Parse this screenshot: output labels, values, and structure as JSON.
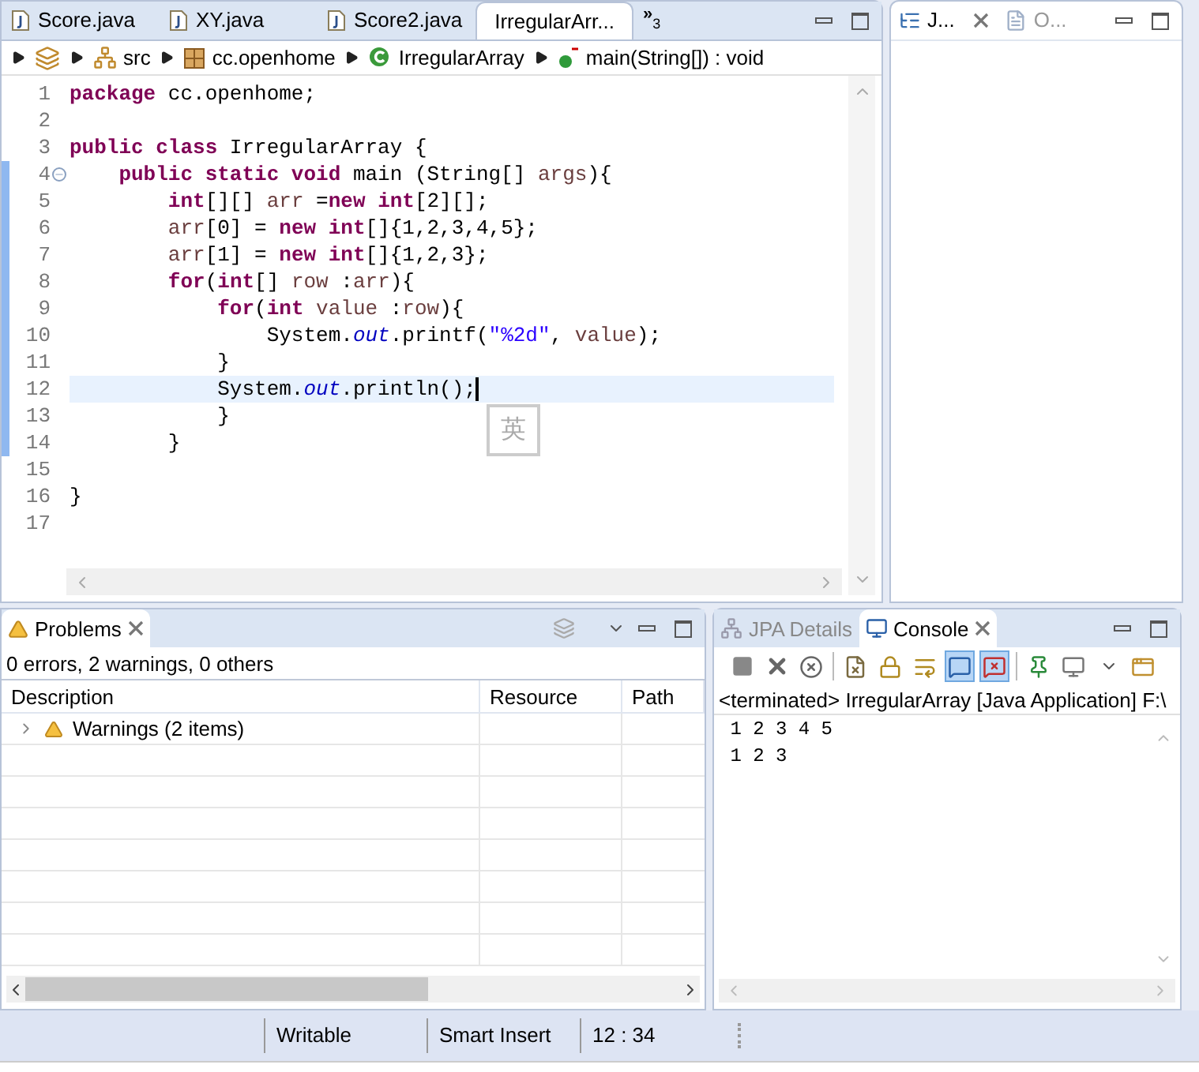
{
  "editor": {
    "tabs": [
      {
        "label": "Score.java",
        "selected": false
      },
      {
        "label": "XY.java",
        "selected": false
      },
      {
        "label": "Score2.java",
        "selected": false
      },
      {
        "label": "IrregularArr...",
        "selected": true
      }
    ],
    "overflow": {
      "symbol": "»",
      "count": "3"
    },
    "breadcrumb": [
      {
        "kind": "project"
      },
      {
        "kind": "folder",
        "label": "src"
      },
      {
        "kind": "package",
        "label": "cc.openhome"
      },
      {
        "kind": "class",
        "label": "IrregularArray"
      },
      {
        "kind": "method",
        "label": "main(String[]) : void"
      }
    ],
    "lines": [
      {
        "number": "1",
        "changed": false,
        "current": false,
        "tokens": [
          {
            "kind": "keyword",
            "text": "package"
          },
          {
            "kind": "plain",
            "text": " cc.openhome;"
          }
        ]
      },
      {
        "number": "2",
        "changed": false,
        "current": false
      },
      {
        "number": "3",
        "changed": false,
        "current": false,
        "tokens": [
          {
            "kind": "keyword",
            "text": "public class"
          },
          {
            "kind": "plain",
            "text": " IrregularArray {"
          }
        ]
      },
      {
        "number": "4",
        "changed": true,
        "current": false,
        "foldable": true,
        "tokens": [
          {
            "kind": "keyword",
            "text": "    public static void"
          },
          {
            "kind": "plain",
            "text": " main (String[] "
          },
          {
            "kind": "variable",
            "text": "args"
          },
          {
            "kind": "plain",
            "text": "){"
          }
        ]
      },
      {
        "number": "5",
        "changed": true,
        "current": false,
        "tokens": [
          {
            "kind": "keyword",
            "text": "        int"
          },
          {
            "kind": "plain",
            "text": "[][] "
          },
          {
            "kind": "variable",
            "text": "arr"
          },
          {
            "kind": "plain",
            "text": " ="
          },
          {
            "kind": "keyword",
            "text": "new int"
          },
          {
            "kind": "plain",
            "text": "[2][];"
          }
        ]
      },
      {
        "number": "6",
        "changed": true,
        "current": false,
        "tokens": [
          {
            "kind": "variable",
            "text": "        arr"
          },
          {
            "kind": "plain",
            "text": "[0] = "
          },
          {
            "kind": "keyword",
            "text": "new int"
          },
          {
            "kind": "plain",
            "text": "[]{1,2,3,4,5};"
          }
        ]
      },
      {
        "number": "7",
        "changed": true,
        "current": false,
        "tokens": [
          {
            "kind": "variable",
            "text": "        arr"
          },
          {
            "kind": "plain",
            "text": "[1] = "
          },
          {
            "kind": "keyword",
            "text": "new int"
          },
          {
            "kind": "plain",
            "text": "[]{1,2,3};"
          }
        ]
      },
      {
        "number": "8",
        "changed": true,
        "current": false,
        "tokens": [
          {
            "kind": "keyword",
            "text": "        for"
          },
          {
            "kind": "plain",
            "text": "("
          },
          {
            "kind": "keyword",
            "text": "int"
          },
          {
            "kind": "plain",
            "text": "[] "
          },
          {
            "kind": "variable",
            "text": "row"
          },
          {
            "kind": "plain",
            "text": " :"
          },
          {
            "kind": "variable",
            "text": "arr"
          },
          {
            "kind": "plain",
            "text": "){"
          }
        ]
      },
      {
        "number": "9",
        "changed": true,
        "current": false,
        "tokens": [
          {
            "kind": "keyword",
            "text": "            for"
          },
          {
            "kind": "plain",
            "text": "("
          },
          {
            "kind": "keyword",
            "text": "int"
          },
          {
            "kind": "variable",
            "text": " value"
          },
          {
            "kind": "plain",
            "text": " :"
          },
          {
            "kind": "variable",
            "text": "row"
          },
          {
            "kind": "plain",
            "text": "){"
          }
        ]
      },
      {
        "number": "10",
        "changed": true,
        "current": false,
        "tokens": [
          {
            "kind": "plain",
            "text": "                System."
          },
          {
            "kind": "field",
            "text": "out"
          },
          {
            "kind": "plain",
            "text": ".printf("
          },
          {
            "kind": "string",
            "text": "\"%2d\""
          },
          {
            "kind": "plain",
            "text": ", "
          },
          {
            "kind": "variable",
            "text": "value"
          },
          {
            "kind": "plain",
            "text": ");"
          }
        ]
      },
      {
        "number": "11",
        "changed": true,
        "current": false,
        "tokens": [
          {
            "kind": "plain",
            "text": "            }"
          }
        ]
      },
      {
        "number": "12",
        "changed": true,
        "current": true,
        "tokens": [
          {
            "kind": "plain",
            "text": "            System."
          },
          {
            "kind": "field",
            "text": "out"
          },
          {
            "kind": "plain",
            "text": ".println();"
          }
        ]
      },
      {
        "number": "13",
        "changed": true,
        "current": false,
        "tokens": [
          {
            "kind": "plain",
            "text": "            }"
          }
        ]
      },
      {
        "number": "14",
        "changed": true,
        "current": false,
        "tokens": [
          {
            "kind": "plain",
            "text": "        }"
          }
        ]
      },
      {
        "number": "15",
        "changed": false,
        "current": false
      },
      {
        "number": "16",
        "changed": false,
        "current": false,
        "tokens": [
          {
            "kind": "plain",
            "text": "}"
          }
        ]
      },
      {
        "number": "17",
        "changed": false,
        "current": false
      }
    ],
    "ime_indicator": "英"
  },
  "side_panel": {
    "tabs": [
      {
        "kind": "hierarchy",
        "label": "J...",
        "selected": true
      },
      {
        "kind": "outline",
        "label": "O...",
        "selected": false
      }
    ]
  },
  "problems": {
    "tab": "Problems",
    "summary": "0 errors, 2 warnings, 0 others",
    "columns": [
      "Description",
      "Resource",
      "Path"
    ],
    "rows": [
      {
        "label": "Warnings (2 items)",
        "expanded": false
      }
    ]
  },
  "console": {
    "tabs": [
      {
        "kind": "jpa",
        "label": "JPA Details",
        "selected": false
      },
      {
        "kind": "console",
        "label": "Console",
        "selected": true
      }
    ],
    "toolbar": [
      {
        "kind": "stop",
        "pressed": false
      },
      {
        "kind": "remove",
        "pressed": false
      },
      {
        "kind": "remove-all",
        "pressed": false
      },
      {
        "kind": "sep"
      },
      {
        "kind": "clear",
        "pressed": false
      },
      {
        "kind": "lock",
        "pressed": false
      },
      {
        "kind": "word-wrap",
        "pressed": false
      },
      {
        "kind": "show-out",
        "pressed": true
      },
      {
        "kind": "show-err",
        "pressed": true
      },
      {
        "kind": "sep"
      },
      {
        "kind": "pin",
        "pressed": false
      },
      {
        "kind": "display",
        "pressed": false
      },
      {
        "kind": "dropdown",
        "pressed": false
      },
      {
        "kind": "new",
        "pressed": false
      }
    ],
    "header": "<terminated> IrregularArray [Java Application] F:\\",
    "output": [
      " 1 2 3 4 5",
      " 1 2 3"
    ]
  },
  "status_bar": [
    "Writable",
    "Smart Insert",
    "12 : 34"
  ]
}
